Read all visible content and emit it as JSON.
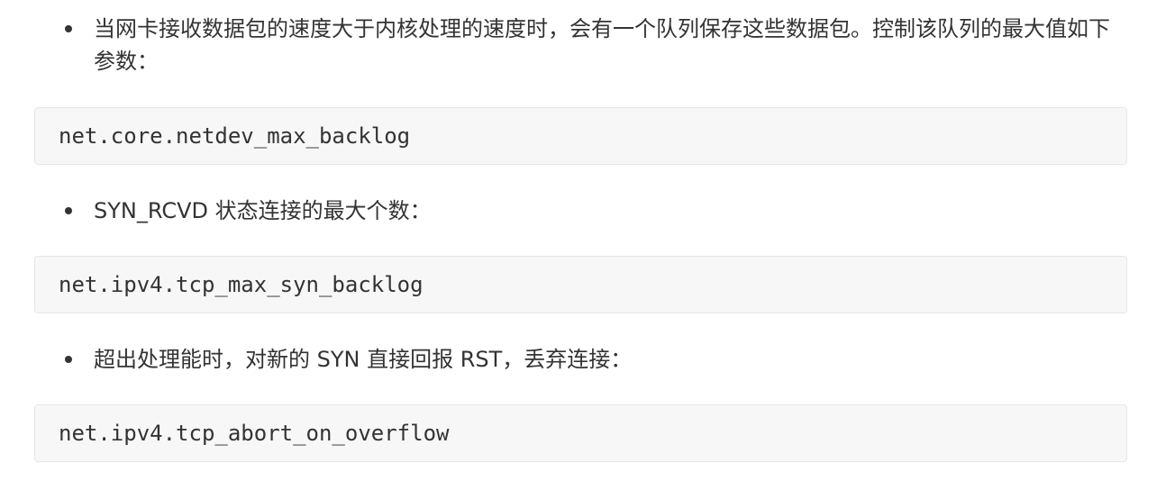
{
  "items": [
    {
      "text": "当网卡接收数据包的速度大于内核处理的速度时，会有一个队列保存这些数据包。控制该队列的最大值如下参数：",
      "code": "net.core.netdev_max_backlog"
    },
    {
      "text": "SYN_RCVD 状态连接的最大个数：",
      "code": "net.ipv4.tcp_max_syn_backlog"
    },
    {
      "text": "超出处理能时，对新的 SYN 直接回报 RST，丢弃连接：",
      "code": "net.ipv4.tcp_abort_on_overflow"
    }
  ]
}
